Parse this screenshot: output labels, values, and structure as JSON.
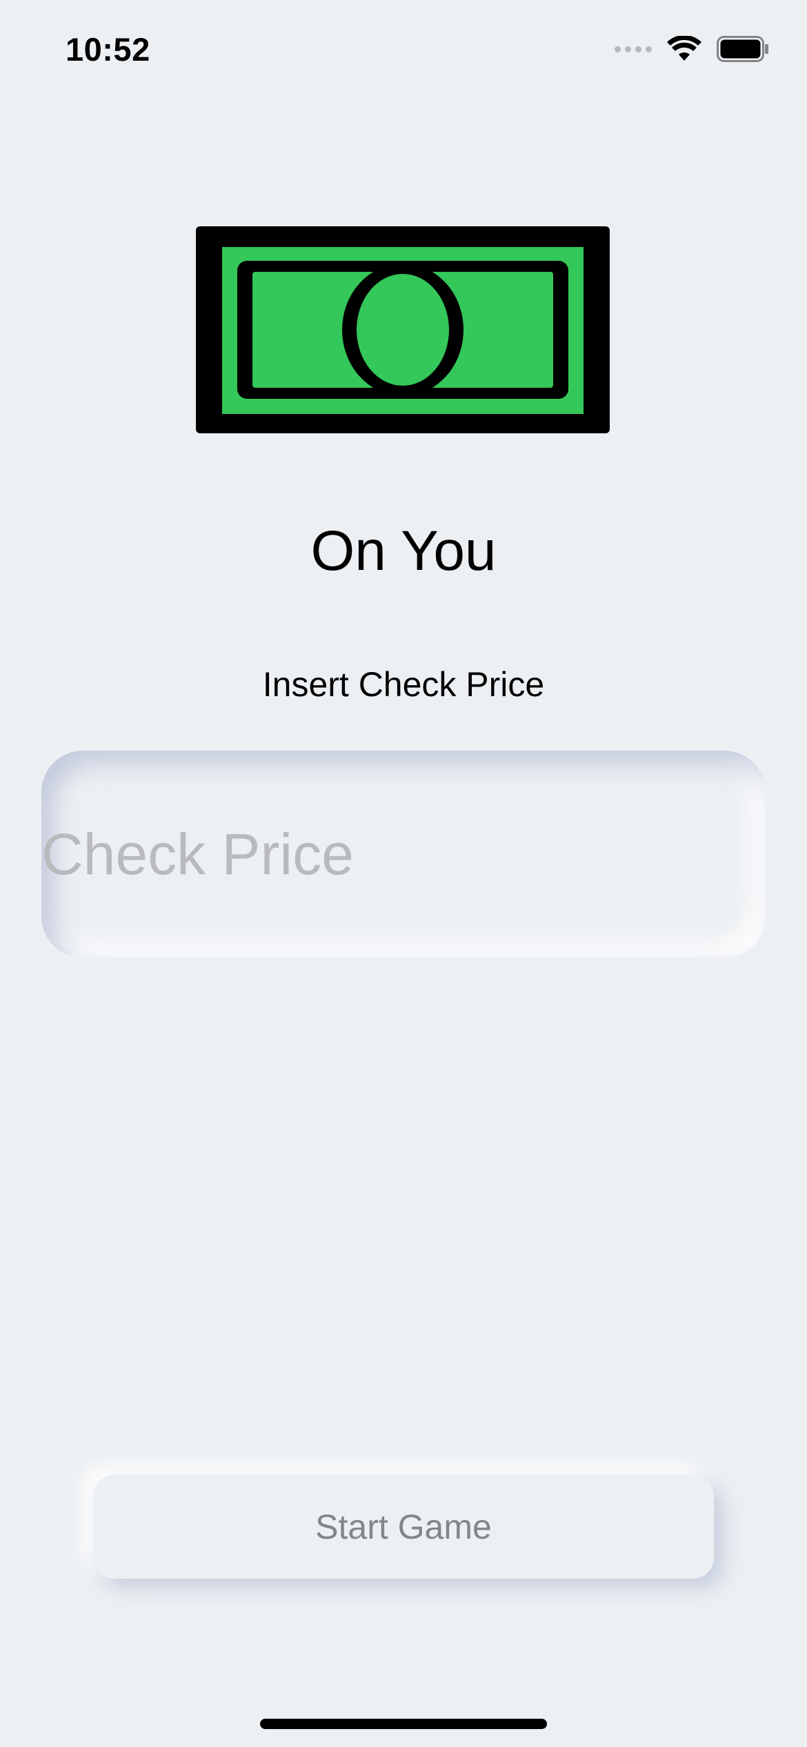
{
  "status_bar": {
    "time": "10:52",
    "icons": [
      "cellular-signal-icon",
      "wifi-icon",
      "battery-icon"
    ]
  },
  "hero": {
    "icon": "dollar-bill-icon",
    "bill_color": "#34c759",
    "outline_color": "#000000"
  },
  "title": "On You",
  "subtitle": "Insert Check Price",
  "price_input": {
    "placeholder": "Check Price",
    "value": ""
  },
  "start_button": {
    "label": "Start Game"
  },
  "colors": {
    "background": "#edf0f3",
    "placeholder": "#b9babd",
    "button_text": "#838588"
  }
}
